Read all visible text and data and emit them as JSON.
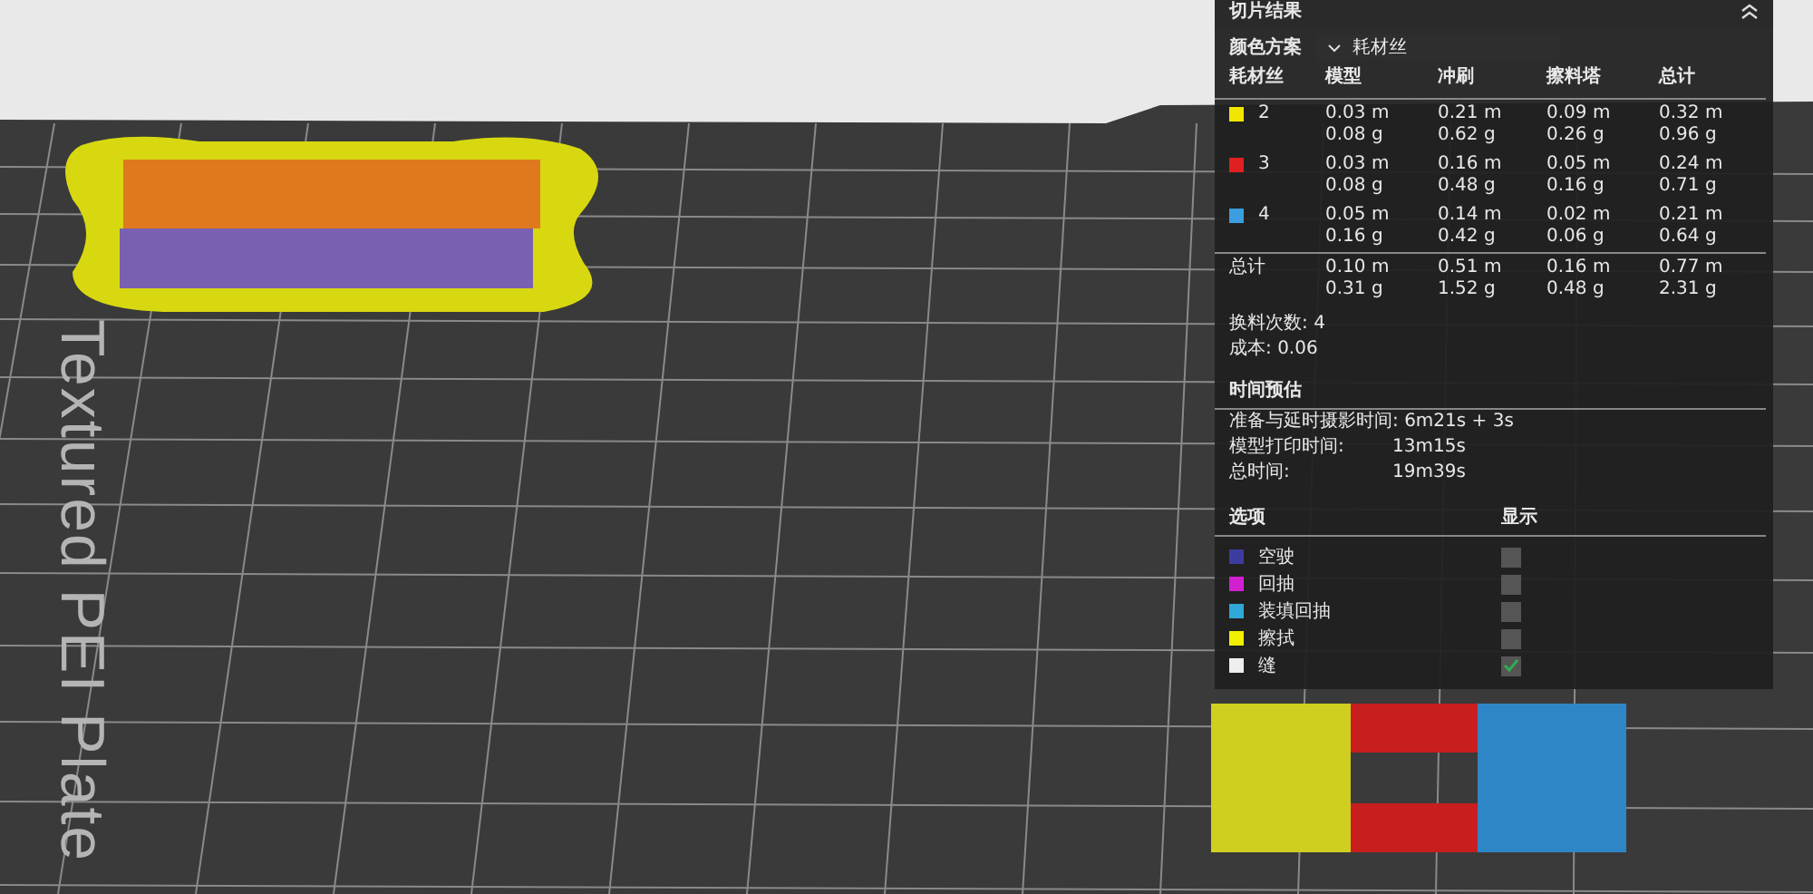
{
  "scene": {
    "plate_label": "Textured PEI Plate"
  },
  "panel": {
    "title": "切片结果",
    "color_scheme": {
      "label": "颜色方案",
      "value": "耗材丝"
    },
    "filament_table": {
      "columns": [
        "耗材丝",
        "模型",
        "冲刷",
        "擦料塔",
        "总计"
      ],
      "rows": [
        {
          "color": "#f2e600",
          "cells": [
            "2",
            [
              "0.03 m",
              "0.08 g"
            ],
            [
              "0.21 m",
              "0.62 g"
            ],
            [
              "0.09 m",
              "0.26 g"
            ],
            [
              "0.32 m",
              "0.96 g"
            ]
          ]
        },
        {
          "color": "#e02020",
          "cells": [
            "3",
            [
              "0.03 m",
              "0.08 g"
            ],
            [
              "0.16 m",
              "0.48 g"
            ],
            [
              "0.05 m",
              "0.16 g"
            ],
            [
              "0.24 m",
              "0.71 g"
            ]
          ]
        },
        {
          "color": "#3a9ee0",
          "cells": [
            "4",
            [
              "0.05 m",
              "0.16 g"
            ],
            [
              "0.14 m",
              "0.42 g"
            ],
            [
              "0.02 m",
              "0.06 g"
            ],
            [
              "0.21 m",
              "0.64 g"
            ]
          ]
        }
      ],
      "total": {
        "cells": [
          "总计",
          [
            "0.10 m",
            "0.31 g"
          ],
          [
            "0.51 m",
            "1.52 g"
          ],
          [
            "0.16 m",
            "0.48 g"
          ],
          [
            "0.77 m",
            "2.31 g"
          ]
        ]
      }
    },
    "stats": [
      {
        "label": "换料次数:",
        "value": "4"
      },
      {
        "label": "成本:",
        "value": "0.06"
      }
    ],
    "time_estimate": {
      "title": "时间预估",
      "rows": [
        {
          "label": "准备与延时摄影时间:",
          "value": "6m21s + 3s"
        },
        {
          "label": "模型打印时间:",
          "value": "13m15s"
        },
        {
          "label": "总时间:",
          "value": "19m39s"
        }
      ]
    },
    "options": {
      "columns": [
        "选项",
        "显示"
      ],
      "items": [
        {
          "color": "#3c3ca0",
          "label": "空驶",
          "checked": false
        },
        {
          "color": "#d020d0",
          "label": "回抽",
          "checked": false
        },
        {
          "color": "#30a8d8",
          "label": "装填回抽",
          "checked": false
        },
        {
          "color": "#f0f000",
          "label": "擦拭",
          "checked": false
        },
        {
          "color": "#eeeeee",
          "label": "缝",
          "checked": true
        }
      ]
    }
  }
}
